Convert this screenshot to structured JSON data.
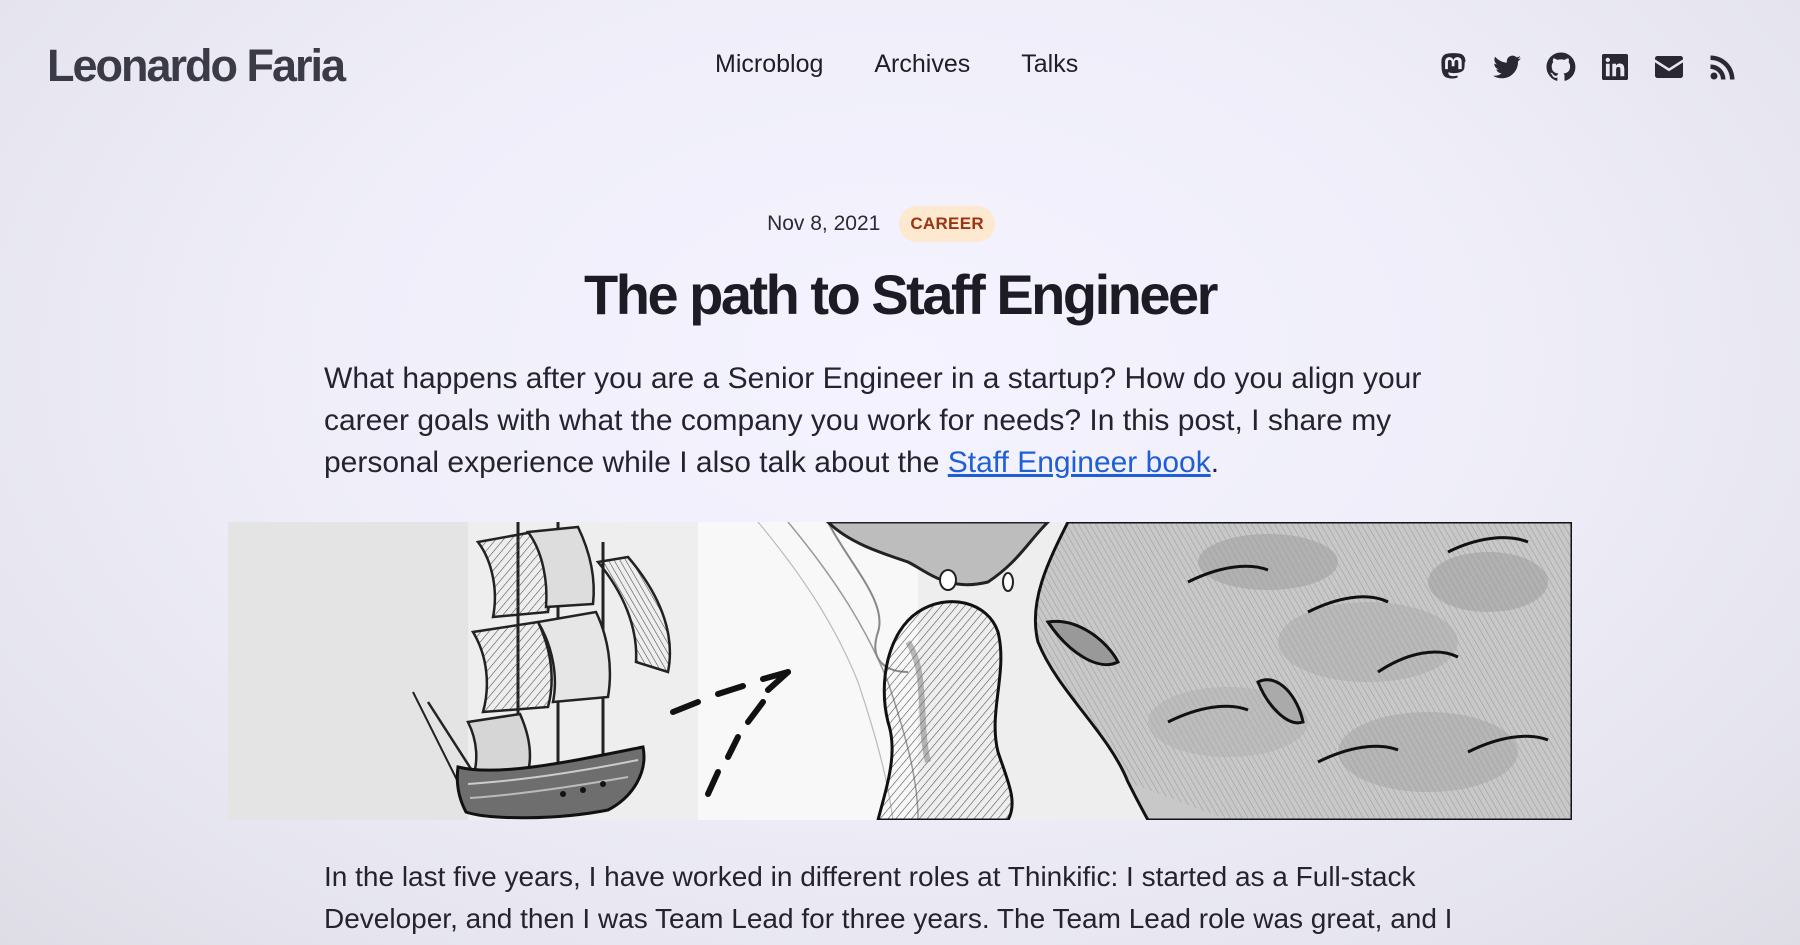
{
  "header": {
    "site_title": "Leonardo Faria",
    "nav": [
      {
        "label": "Microblog"
      },
      {
        "label": "Archives"
      },
      {
        "label": "Talks"
      }
    ],
    "social_icons": [
      "mastodon-icon",
      "twitter-icon",
      "github-icon",
      "linkedin-icon",
      "email-icon",
      "rss-icon"
    ]
  },
  "post": {
    "date": "Nov 8, 2021",
    "tag": "CAREER",
    "title": "The path to Staff Engineer",
    "intro_text": "What happens after you are a Senior Engineer in a startup? How do you align your career goals with what the company you work for needs? In this post, I share my personal experience while I also talk about the ",
    "intro_link": "Staff Engineer book",
    "intro_end": ".",
    "body_line_1": "In the last five years, I have worked in different roles at Thinkific: I started as a Full-stack",
    "body_line_2": "Developer, and then I was Team Lead for three years. The Team Lead role was great, and I"
  },
  "colors": {
    "link": "#1f5fd6",
    "tag_text": "#9a3412",
    "tag_bg": "#fde8d0",
    "background": "#efeef9"
  }
}
